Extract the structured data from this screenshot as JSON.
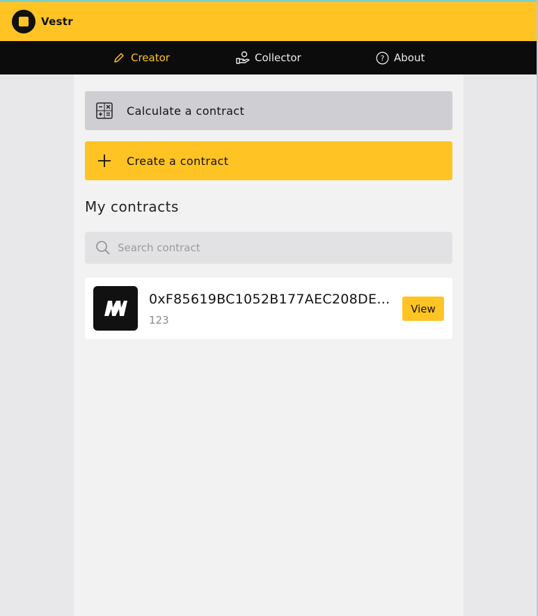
{
  "app": {
    "name": "Vestr",
    "accent": "#ffc423"
  },
  "nav": {
    "items": [
      {
        "label": "Creator",
        "icon": "pencil-icon",
        "active": true
      },
      {
        "label": "Collector",
        "icon": "hand-coin-icon",
        "active": false
      },
      {
        "label": "About",
        "icon": "question-circle-icon",
        "active": false
      }
    ]
  },
  "actions": {
    "calculate_label": "Calculate a contract",
    "calculate_icon": "calculator-icon",
    "create_label": "Create a contract",
    "create_icon": "plus-icon"
  },
  "contracts": {
    "title": "My contracts",
    "search_placeholder": "Search contract",
    "search_value": "",
    "items": [
      {
        "address": "0xF85619BC1052B177AEC208DE…",
        "subtitle": "123",
        "thumb_icon": "mn-logo-icon",
        "view_label": "View"
      }
    ]
  }
}
